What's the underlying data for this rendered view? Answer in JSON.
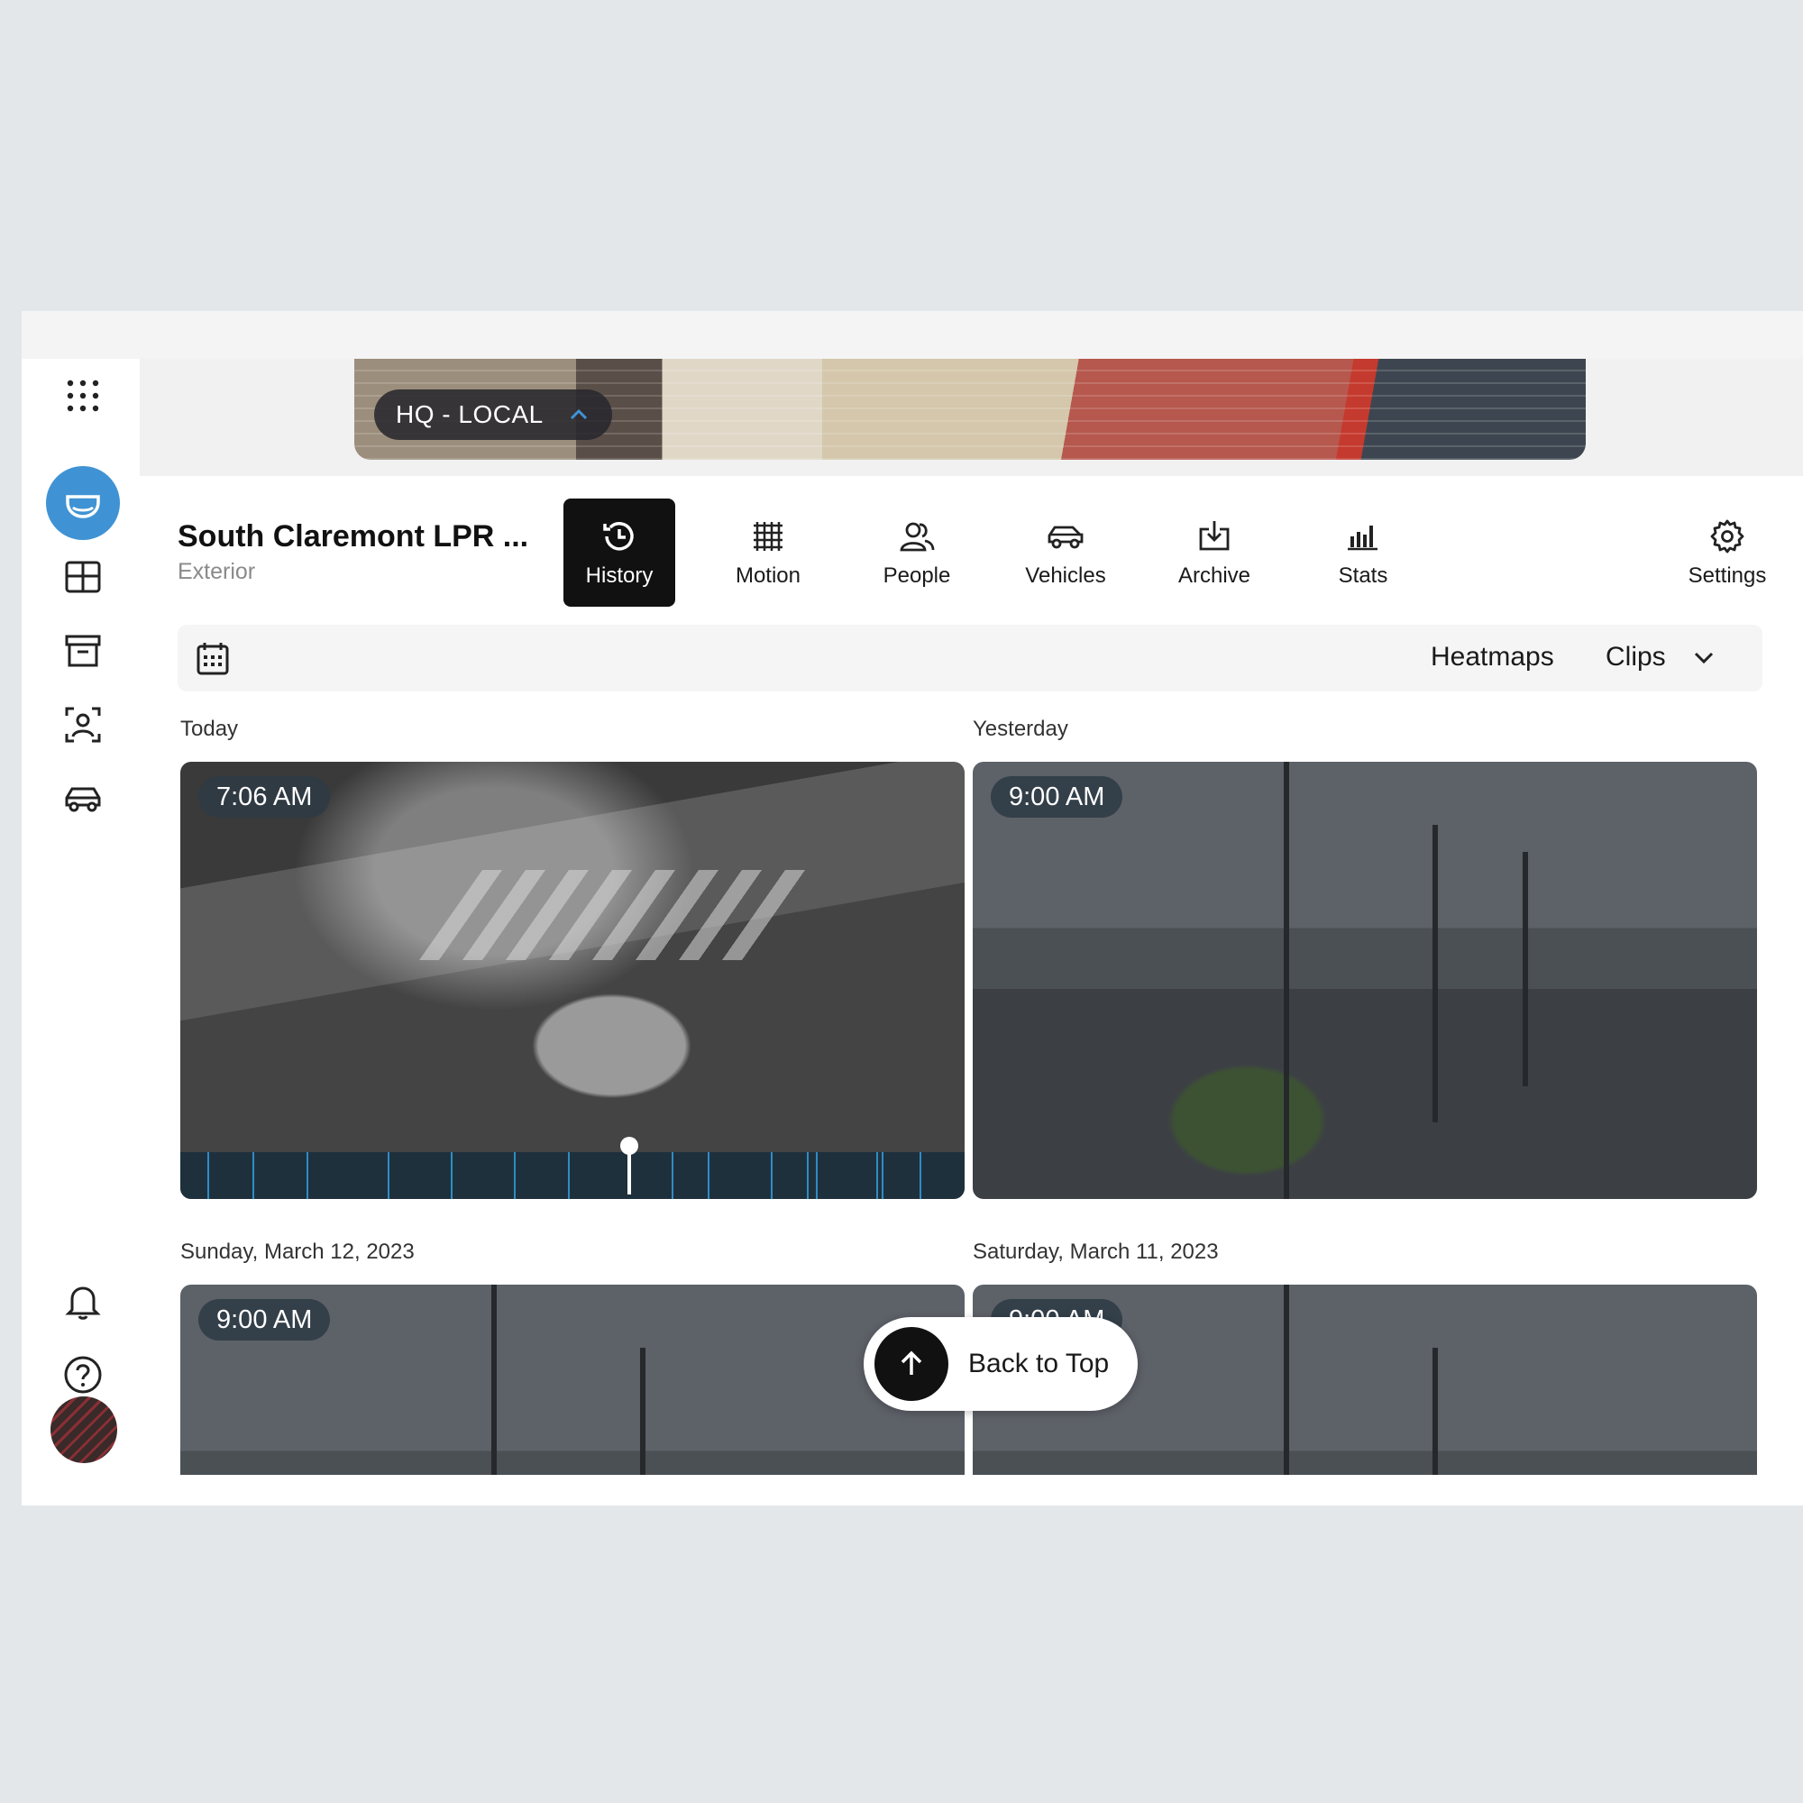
{
  "location": {
    "label": "HQ - LOCAL"
  },
  "camera": {
    "title": "South Claremont LPR ...",
    "subtitle": "Exterior"
  },
  "tabs": [
    {
      "label": "History",
      "icon": "history-icon",
      "active": true
    },
    {
      "label": "Motion",
      "icon": "grid-icon",
      "active": false
    },
    {
      "label": "People",
      "icon": "people-icon",
      "active": false
    },
    {
      "label": "Vehicles",
      "icon": "car-icon",
      "active": false
    },
    {
      "label": "Archive",
      "icon": "download-icon",
      "active": false
    },
    {
      "label": "Stats",
      "icon": "bar-chart-icon",
      "active": false
    },
    {
      "label": "Settings",
      "icon": "gear-icon",
      "active": false
    }
  ],
  "filter": {
    "heatmaps": "Heatmaps",
    "clips": "Clips"
  },
  "days": [
    {
      "label": "Today",
      "time": "7:06 AM"
    },
    {
      "label": "Yesterday",
      "time": "9:00 AM"
    },
    {
      "label": "Sunday, March 12, 2023",
      "time": "9:00 AM"
    },
    {
      "label": "Saturday, March 11, 2023",
      "time": "9:00 AM"
    }
  ],
  "back_to_top": "Back to Top",
  "colors": {
    "accent": "#3f93d4",
    "active_tab": "#111111",
    "timeline_tick": "#2e8dc4"
  },
  "sidebar_icons": [
    "apps-grid-icon",
    "camera-dome-icon",
    "layout-grid-icon",
    "archive-box-icon",
    "person-detect-icon",
    "vehicle-icon",
    "bell-icon",
    "help-icon",
    "avatar"
  ]
}
